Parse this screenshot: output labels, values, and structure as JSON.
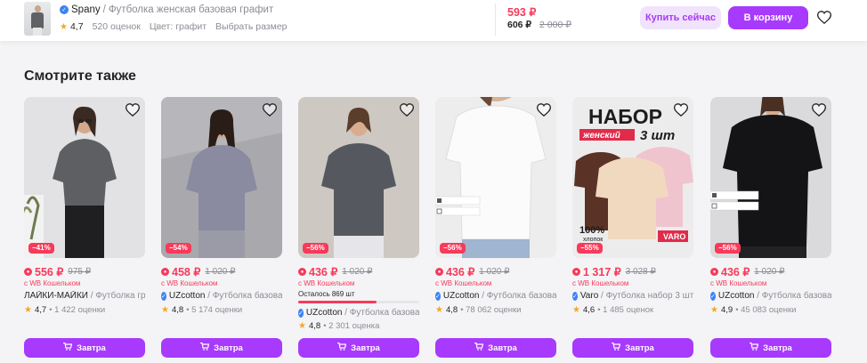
{
  "header": {
    "brand": "Spany",
    "separator": "/",
    "title": "Футболка женская базовая графит",
    "rating": "4,7",
    "reviews": "520 оценок",
    "color": "Цвет: графит",
    "size_link": "Выбрать размер",
    "price": "593 ₽",
    "wallet_price": "606 ₽",
    "old_price": "2 000 ₽",
    "buy_now_label": "Купить сейчас",
    "cart_label": "В корзину"
  },
  "section_title": "Смотрите также",
  "colors": {
    "accent": "#a73afd",
    "price": "#f73a5a",
    "muted": "#8c8c96"
  },
  "cards": [
    {
      "discount": "−41%",
      "price": "556 ₽",
      "old_price": "975 ₽",
      "wallet": "с WB Кошельком",
      "brand": "ЛАЙКИ-МАЙКИ",
      "title": "/ Футболка гр...",
      "verified": false,
      "rating": "4,7",
      "reviews": "• 1 422 оценки",
      "button": "Завтра"
    },
    {
      "discount": "−54%",
      "price": "458 ₽",
      "old_price": "1 020 ₽",
      "wallet": "с WB Кошельком",
      "brand": "UZcotton",
      "title": "/ Футболка базова...",
      "verified": true,
      "rating": "4,8",
      "reviews": "• 5 174 оценки",
      "button": "Завтра"
    },
    {
      "discount": "−56%",
      "price": "436 ₽",
      "old_price": "1 020 ₽",
      "wallet": "с WB Кошельком",
      "stock_left": "Осталось 869 шт",
      "stock_fraction": 0.65,
      "brand": "UZcotton",
      "title": "/ Футболка базова...",
      "verified": true,
      "rating": "4,8",
      "reviews": "• 2 301 оценка",
      "button": "Завтра"
    },
    {
      "discount": "−56%",
      "price": "436 ₽",
      "old_price": "1 020 ₽",
      "wallet": "с WB Кошельком",
      "brand": "UZcotton",
      "title": "/ Футболка базова...",
      "verified": true,
      "rating": "4,8",
      "reviews": "• 78 062 оценки",
      "button": "Завтра"
    },
    {
      "discount": "−55%",
      "price": "1 317 ₽",
      "old_price": "3 028 ₽",
      "wallet": "с WB Кошельком",
      "brand": "Varo",
      "title": "/ Футболка набор 3 шт",
      "verified": true,
      "rating": "4,6",
      "reviews": "• 1 485 оценок",
      "button": "Завтра",
      "promo": {
        "line1": "НАБОР",
        "line2": "женский",
        "line3": "3 шт",
        "cotton": "100%",
        "cotton_label": "хлопок",
        "logo": "VARO"
      }
    },
    {
      "discount": "−56%",
      "price": "436 ₽",
      "old_price": "1 020 ₽",
      "wallet": "с WB Кошельком",
      "brand": "UZcotton",
      "title": "/ Футболка базова...",
      "verified": true,
      "rating": "4,9",
      "reviews": "• 45 083 оценки",
      "button": "Завтра"
    }
  ]
}
